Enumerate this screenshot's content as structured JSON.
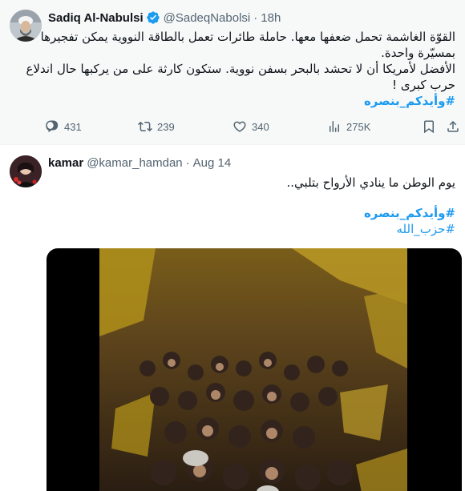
{
  "tweet1": {
    "name": "Sadiq Al-Nabulsi",
    "handle": "@SadeqNabolsi",
    "separator": "·",
    "time": "18h",
    "lines": [
      "القوّة الغاشمة تحمل ضعفها معها. حاملة طائرات تعمل بالطاقة النووية يمكن تفجيرها",
      "بمسيّرة واحدة.",
      "الأفضل لأمريكا أن لا تحشد بالبحر بسفن نووية. ستكون كارثة على من يركبها حال اندلاع",
      "حرب كبرى !"
    ],
    "hashtag": "#وأيدكم_بنصره",
    "actions": {
      "replies": "431",
      "reposts": "239",
      "likes": "340",
      "views": "275K"
    },
    "icons": [
      "verified-badge-icon",
      "reply-icon",
      "repost-icon",
      "like-icon",
      "views-icon",
      "bookmark-icon",
      "share-icon"
    ]
  },
  "tweet2": {
    "name": "kamar",
    "handle": "@kamar_hamdan",
    "separator": "·",
    "time": "Aug 14",
    "text": "يوم الوطن ما ينادي الأرواح بتلبي..",
    "hashtag1": "#وأيدكم_بنصره",
    "hashtag2": "#حزب_الله"
  },
  "colors": {
    "accent": "#1d9bf0",
    "secondary_text": "#536471",
    "primary_text": "#0f1419",
    "highlight_background": "#f7f9f9"
  }
}
